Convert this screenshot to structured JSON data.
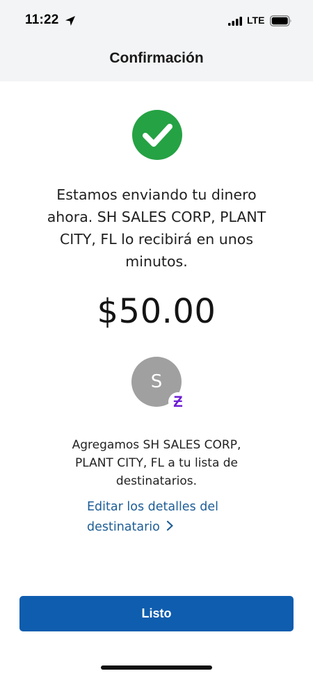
{
  "status_bar": {
    "time": "11:22",
    "network": "LTE",
    "icons": [
      "location-arrow-icon",
      "signal-icon",
      "battery-icon"
    ]
  },
  "header": {
    "title": "Confirmación"
  },
  "confirmation": {
    "icon": "checkmark-circle-icon",
    "message": "Estamos enviando tu dinero ahora. SH SALES CORP, PLANT CITY, FL lo recibirá en unos minutos.",
    "amount": "$50.00"
  },
  "recipient": {
    "avatar_initial": "S",
    "badge_glyph": "Ƶ",
    "badge_icon": "zelle-icon",
    "added_message": "Agregamos SH SALES CORP, PLANT CITY, FL a tu lista de destinatarios.",
    "edit_link_label": "Editar los detalles del destinatario"
  },
  "actions": {
    "done_label": "Listo"
  },
  "colors": {
    "header_background": "#f3f4f5",
    "success_green": "#25a244",
    "link_blue": "#1d5d96",
    "primary_button": "#0f5dae",
    "avatar_gray": "#a0a0a0",
    "zelle_purple": "#6d1ed4"
  }
}
